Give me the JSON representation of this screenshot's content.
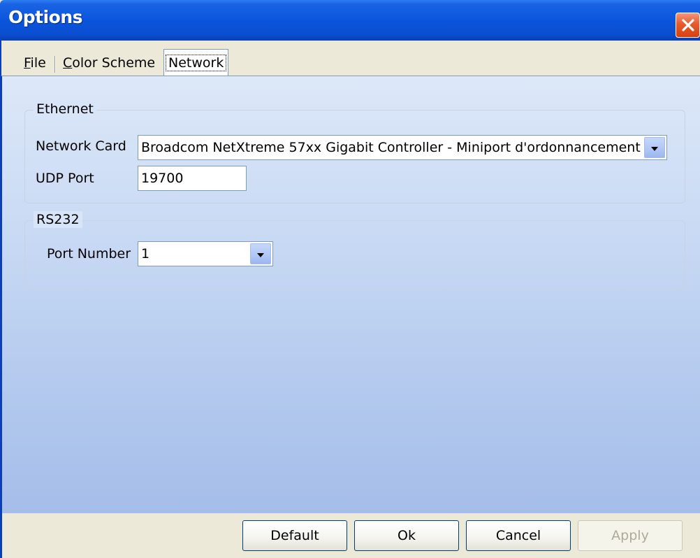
{
  "window": {
    "title": "Options"
  },
  "tabs": {
    "file": {
      "label": "File",
      "underline": "F",
      "rest": "ile"
    },
    "color_scheme": {
      "label": "Color Scheme",
      "underline": "C",
      "rest": "olor Scheme"
    },
    "network": {
      "label": "Network",
      "active": true
    }
  },
  "ethernet": {
    "group_label": "Ethernet",
    "network_card_label": "Network Card",
    "network_card_value": "Broadcom NetXtreme 57xx Gigabit Controller - Miniport d'ordonnancement de paquets",
    "udp_port_label": "UDP Port",
    "udp_port_value": "19700"
  },
  "rs232": {
    "group_label": "RS232",
    "port_number_label": "Port Number",
    "port_number_value": "1"
  },
  "buttons": {
    "default": "Default",
    "ok": "Ok",
    "cancel": "Cancel",
    "apply": "Apply",
    "apply_enabled": false
  },
  "colors": {
    "title_bar": "#0a55dc",
    "close_button": "#e65a2e",
    "panel_top": "#dde8f8",
    "panel_bottom": "#a5bde9",
    "face": "#ece9d8"
  },
  "icons": {
    "close": "close-icon",
    "dropdown": "chevron-down-icon"
  }
}
